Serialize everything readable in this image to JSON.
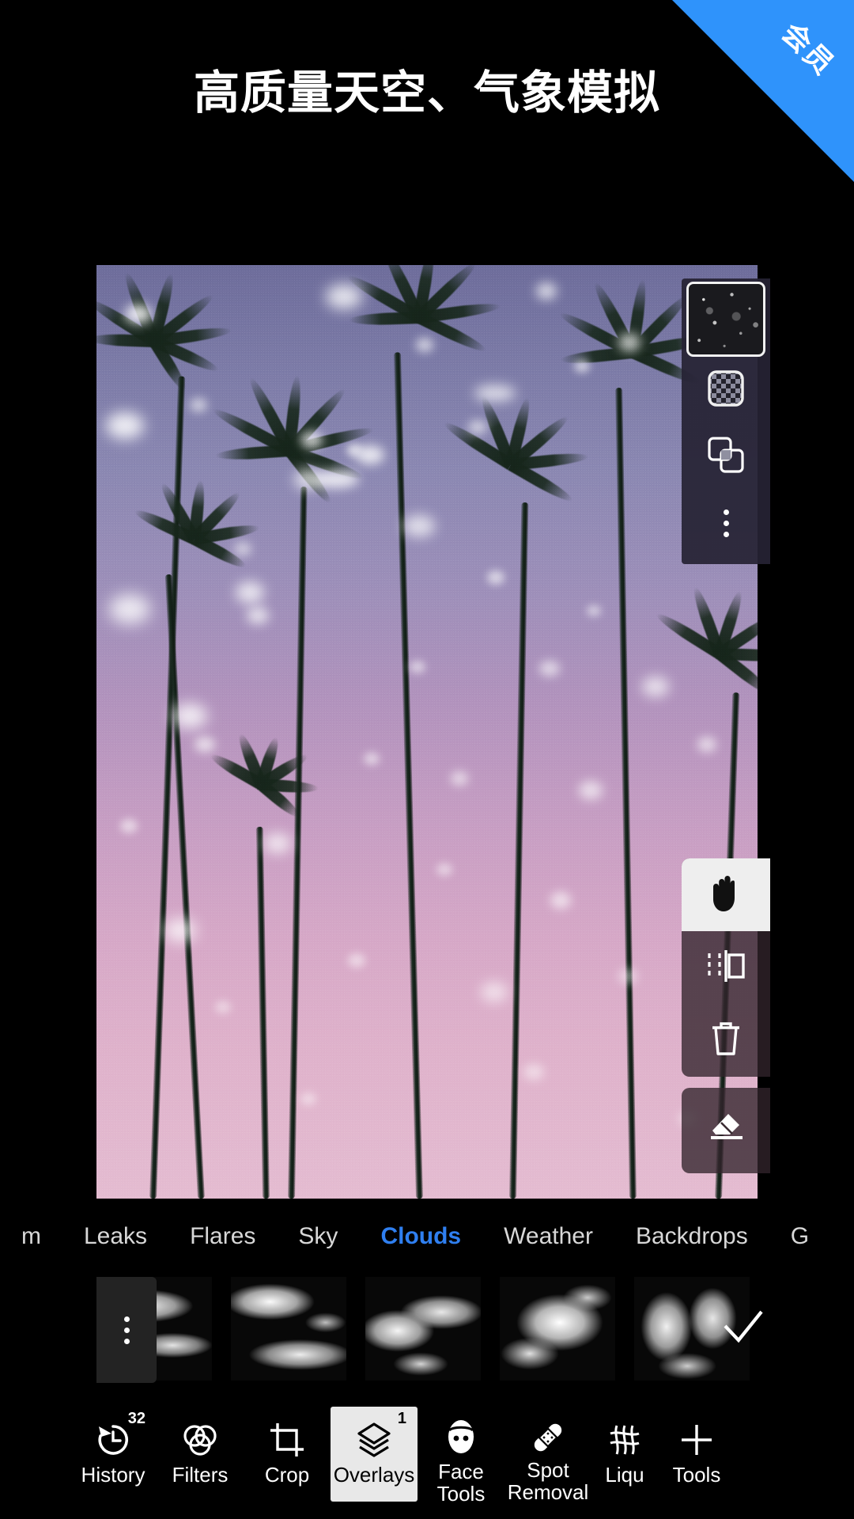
{
  "ribbon": {
    "label": "会员",
    "color": "#2f93fb"
  },
  "headline": {
    "text": "高质量天空、气象模拟"
  },
  "canvas": {
    "alt": "palm-trees-sunset-sky-photo",
    "sky_top_color": "#6e6d9b",
    "sky_bottom_color": "#e4bcd1"
  },
  "layers_panel": {
    "thumbnail_name": "snow-overlay-layer-thumbnail",
    "buttons": [
      {
        "name": "opacity-checkerboard-icon",
        "label": "Opacity"
      },
      {
        "name": "blend-mode-icon",
        "label": "Blend Mode"
      },
      {
        "name": "more-options-icon",
        "label": "More"
      }
    ]
  },
  "tool_panel": {
    "buttons": [
      {
        "name": "move-hand-icon",
        "label": "Move",
        "active": true
      },
      {
        "name": "flip-mirror-icon",
        "label": "Flip",
        "active": false
      },
      {
        "name": "delete-trash-icon",
        "label": "Delete",
        "active": false
      }
    ],
    "eraser": {
      "name": "eraser-icon",
      "label": "Erase"
    }
  },
  "tabs": {
    "active": "Clouds",
    "items": [
      "m",
      "Leaks",
      "Flares",
      "Sky",
      "Clouds",
      "Weather",
      "Backdrops",
      "G"
    ]
  },
  "overlay_strip": {
    "menu_icon": "more-options-icon",
    "confirm_icon": "checkmark-icon",
    "thumbnails": [
      {
        "name": "cloud-overlay-1"
      },
      {
        "name": "cloud-overlay-2"
      },
      {
        "name": "cloud-overlay-3"
      },
      {
        "name": "cloud-overlay-4"
      },
      {
        "name": "cloud-overlay-5"
      }
    ]
  },
  "bottom_toolbar": {
    "active": "Overlays",
    "items": [
      {
        "label": "History",
        "icon": "history-undo-icon",
        "badge": "32",
        "active": false
      },
      {
        "label": "Filters",
        "icon": "filters-circles-icon",
        "badge": "",
        "active": false
      },
      {
        "label": "Crop",
        "icon": "crop-icon",
        "badge": "",
        "active": false
      },
      {
        "label": "Overlays",
        "icon": "layers-stack-icon",
        "badge": "1",
        "active": true
      },
      {
        "label": "Face\nTools",
        "icon": "face-icon",
        "badge": "",
        "active": false
      },
      {
        "label": "Spot\nRemoval",
        "icon": "bandage-icon",
        "badge": "",
        "active": false
      },
      {
        "label": "Liqu",
        "icon": "liquify-grid-icon",
        "badge": "",
        "active": false
      },
      {
        "label": "Tools",
        "icon": "plus-icon",
        "badge": "",
        "active": false
      }
    ]
  }
}
